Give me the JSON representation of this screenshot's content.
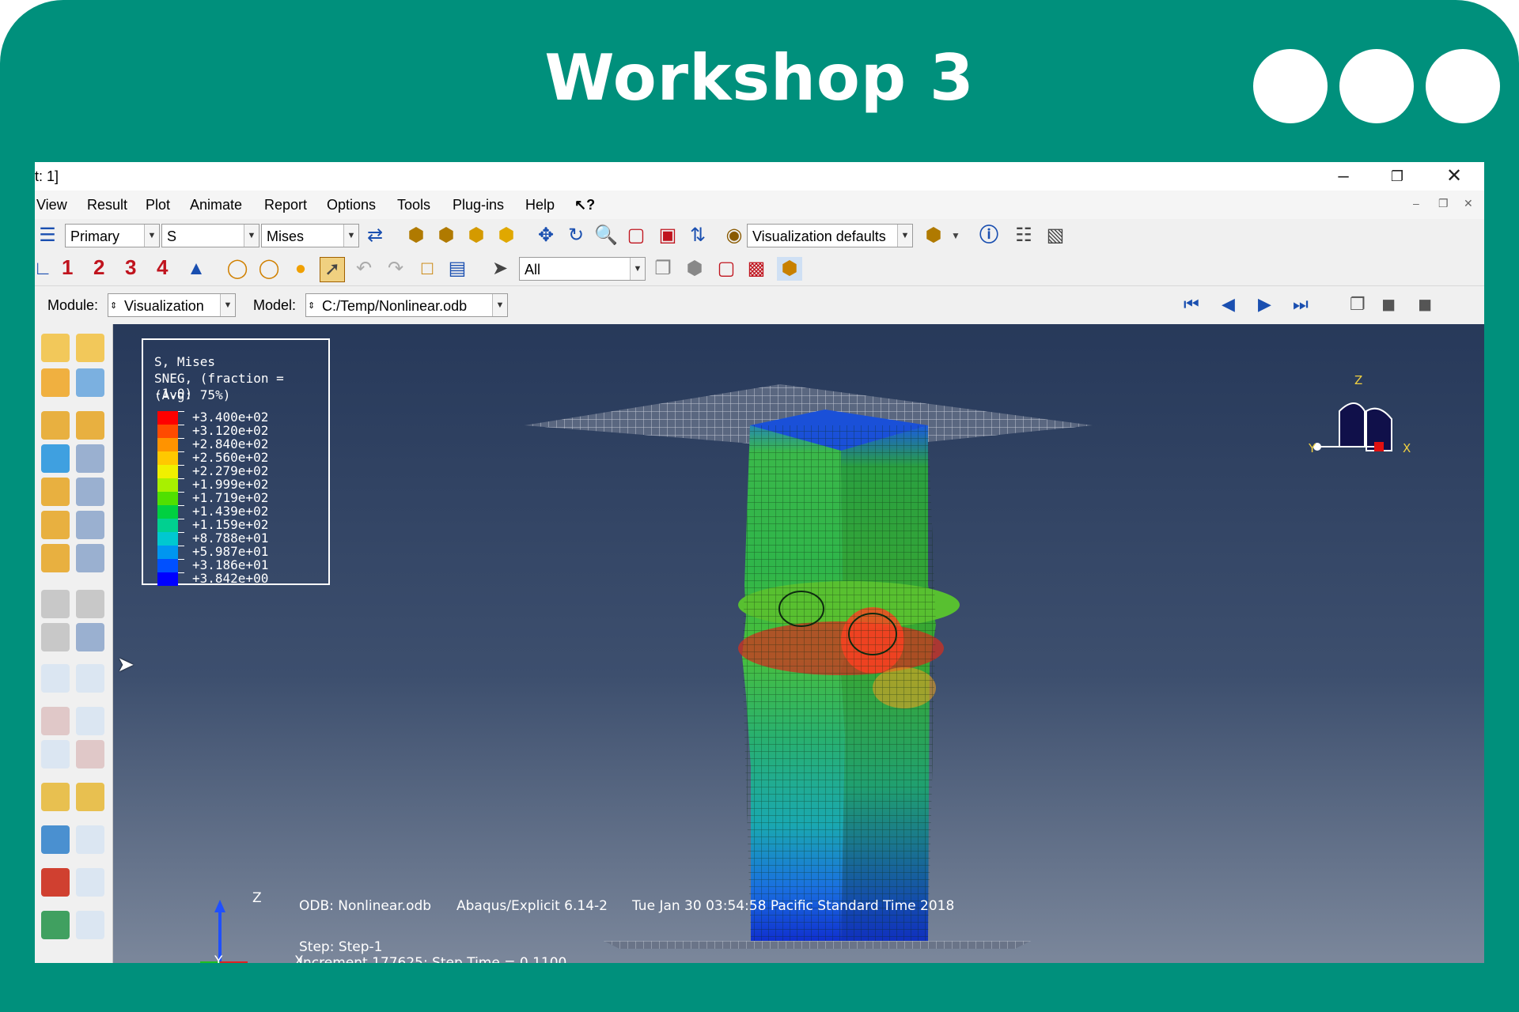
{
  "banner": {
    "title": "Workshop 3"
  },
  "window": {
    "title": "t: 1]"
  },
  "menu": [
    {
      "label": "View"
    },
    {
      "label": "Result"
    },
    {
      "label": "Plot"
    },
    {
      "label": "Animate"
    },
    {
      "label": "Report"
    },
    {
      "label": "Options"
    },
    {
      "label": "Tools"
    },
    {
      "label": "Plug-ins"
    },
    {
      "label": "Help"
    },
    {
      "label": "↖?"
    }
  ],
  "toolbar1": {
    "field_primary": "Primary",
    "field_var": "S",
    "field_comp": "Mises",
    "vis_defaults": "Visualization defaults"
  },
  "toolbar2": {
    "views": [
      "1",
      "2",
      "3",
      "4"
    ],
    "select_filter": "All"
  },
  "context": {
    "module_label": "Module:",
    "module_value": "Visualization",
    "model_label": "Model:",
    "model_value": "C:/Temp/Nonlinear.odb"
  },
  "legend": {
    "line1": "S, Mises",
    "line2": "SNEG, (fraction = -1.0)",
    "line3": "(Avg: 75%)",
    "values": [
      "+3.400e+02",
      "+3.120e+02",
      "+2.840e+02",
      "+2.560e+02",
      "+2.279e+02",
      "+1.999e+02",
      "+1.719e+02",
      "+1.439e+02",
      "+1.159e+02",
      "+8.788e+01",
      "+5.987e+01",
      "+3.186e+01",
      "+3.842e+00"
    ],
    "colors": [
      "#ff0000",
      "#ff4b00",
      "#ff9300",
      "#ffc800",
      "#f0f000",
      "#a8f000",
      "#50e000",
      "#00d040",
      "#00d090",
      "#00c8d0",
      "#0096f0",
      "#0050ff",
      "#0000ff"
    ]
  },
  "triad": {
    "z": "Z",
    "y": "Y",
    "x": "X"
  },
  "viewport_info": {
    "odb": "ODB: Nonlinear.odb",
    "solver": "Abaqus/Explicit 6.14-2",
    "time": "Tue Jan 30 03:54:58 Pacific Standard Time 2018",
    "step": "Step: Step-1",
    "increment": "Increment    177625: Step Time =    0.1100"
  },
  "colors": {
    "frame": "#00907c",
    "icon_blue": "#1a4fb0",
    "view_red": "#c0141e"
  }
}
